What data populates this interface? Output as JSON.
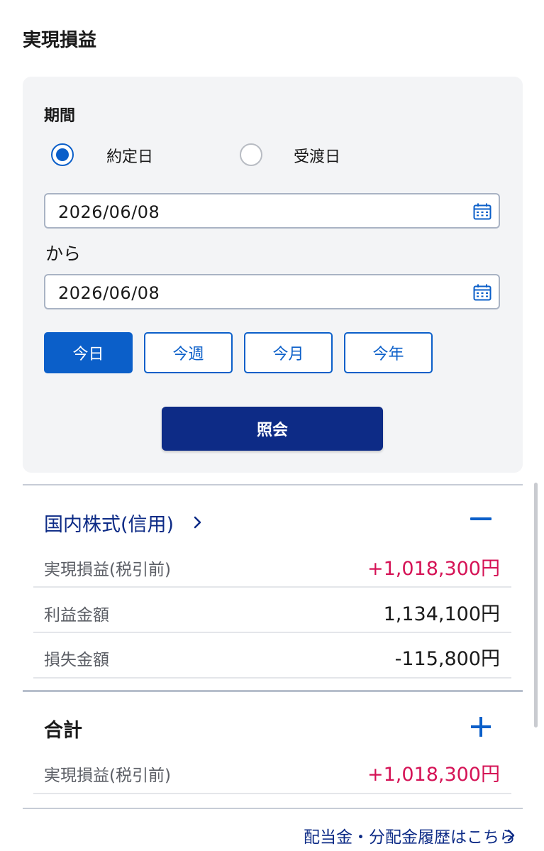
{
  "page": {
    "title": "実現損益"
  },
  "period": {
    "label": "期間",
    "radios": [
      {
        "label": "約定日",
        "selected": true
      },
      {
        "label": "受渡日",
        "selected": false
      }
    ],
    "from_date": "2026/06/08",
    "separator": "から",
    "to_date": "2026/06/08",
    "calendar_icon": "calendar-icon",
    "quick_buttons": [
      {
        "label": "今日",
        "active": true
      },
      {
        "label": "今週",
        "active": false
      },
      {
        "label": "今月",
        "active": false
      },
      {
        "label": "今年",
        "active": false
      }
    ],
    "query_label": "照会"
  },
  "sections": [
    {
      "title": "国内株式(信用)",
      "expanded": true,
      "toggle_icon": "minus-icon",
      "rows": [
        {
          "label": "実現損益(税引前)",
          "value": "+1,018,300円",
          "highlight": true
        },
        {
          "label": "利益金額",
          "value": "1,134,100円",
          "highlight": false
        },
        {
          "label": "損失金額",
          "value": "-115,800円",
          "highlight": false
        }
      ]
    },
    {
      "title": "合計",
      "expanded": false,
      "toggle_icon": "plus-icon",
      "rows": [
        {
          "label": "実現損益(税引前)",
          "value": "+1,018,300円",
          "highlight": true
        }
      ]
    }
  ],
  "footer": {
    "link_label": "配当金・分配金履歴はこちら"
  },
  "colors": {
    "accent": "#0b5fc9",
    "navy": "#0d2b86",
    "profit_red": "#d51356",
    "panel_bg": "#f3f4f6"
  }
}
